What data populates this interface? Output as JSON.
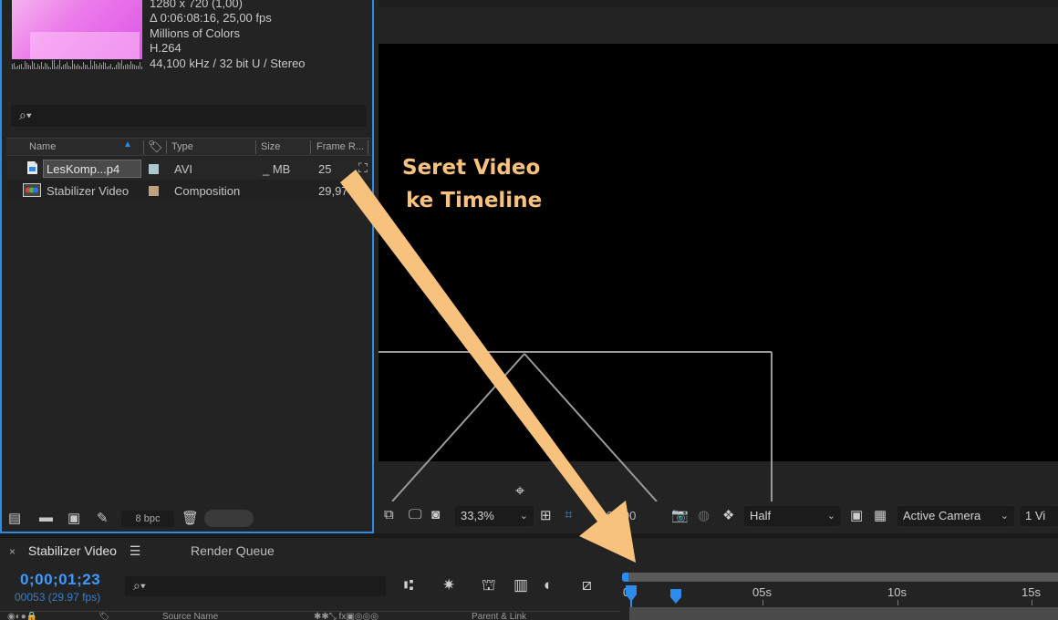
{
  "project_panel": {
    "footage_info": {
      "dimensions": "1280 x 720 (1,00)",
      "duration": "Δ 0:06:08:16, 25,00 fps",
      "color_depth": "Millions of Colors",
      "codec": "H.264",
      "audio": "44,100 kHz / 32 bit U / Stereo"
    },
    "columns": {
      "name": "Name",
      "type": "Type",
      "size": "Size",
      "frame_rate": "Frame R..."
    },
    "items": [
      {
        "name": "LesKomp...p4",
        "type": "AVI",
        "size": "_ MB",
        "frame_rate": "25",
        "label_color": "#a9c9cf",
        "icon": "video-file-icon"
      },
      {
        "name": "Stabilizer Video",
        "type": "Composition",
        "size": "",
        "frame_rate": "29,97",
        "label_color": "#bca27f",
        "icon": "composition-icon"
      }
    ],
    "bpc": "8 bpc"
  },
  "viewer_bar": {
    "magnification": "33,3%",
    "timecode": "0;00;00",
    "resolution": "Half",
    "camera": "Active Camera",
    "views": "1 Vi"
  },
  "timeline": {
    "tab_title": "Stabilizer Video",
    "render_queue": "Render Queue",
    "current_time": "0;00;01;23",
    "frame_info": "00053 (29.97 fps)",
    "layer_header_source": "Source Name",
    "layer_header_parent": "Parent & Link",
    "ruler": [
      "0s",
      "05s",
      "10s",
      "15s"
    ]
  },
  "annotation": {
    "line1": "Seret Video",
    "line2": "ke Timeline",
    "color": "#f7c27e"
  },
  "colors": {
    "accent": "#2d8ceb",
    "panel": "#232323",
    "viewer_bg": "#000000"
  }
}
